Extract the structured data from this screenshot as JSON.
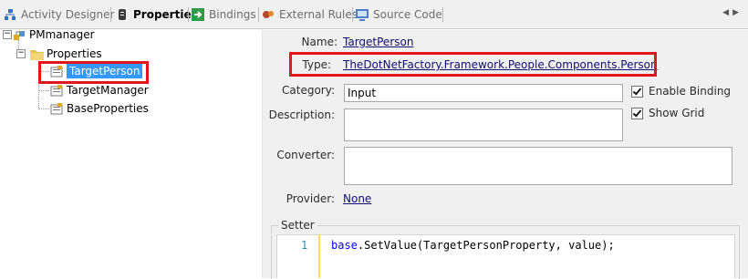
{
  "tabs": [
    {
      "label": "Activity Designer",
      "icon": "activity-designer-icon",
      "active": false
    },
    {
      "label": "Properties",
      "icon": "properties-icon",
      "active": true
    },
    {
      "label": "Bindings",
      "icon": "bindings-icon",
      "active": false
    },
    {
      "label": "External Rules",
      "icon": "external-rules-icon",
      "active": false
    },
    {
      "label": "Source Code",
      "icon": "source-code-icon",
      "active": false
    }
  ],
  "tree": {
    "root": "PMmanager",
    "folder": "Properties",
    "items": [
      "TargetPerson",
      "TargetManager",
      "BaseProperties"
    ],
    "selected": "TargetPerson"
  },
  "details": {
    "name_label": "Name:",
    "name_value": "TargetPerson",
    "type_label": "Type:",
    "type_value": "TheDotNetFactory.Framework.People.Components.Person",
    "category_label": "Category:",
    "category_value": "Input",
    "description_label": "Description:",
    "description_value": "",
    "converter_label": "Converter:",
    "converter_value": "",
    "provider_label": "Provider:",
    "provider_value": "None",
    "enable_binding_label": "Enable Binding",
    "enable_binding_checked": true,
    "show_grid_label": "Show Grid",
    "show_grid_checked": true
  },
  "setter": {
    "title": "Setter",
    "line_number": "1",
    "code_keyword": "base",
    "code_rest": ".SetValue(TargetPersonProperty, value);"
  },
  "colors": {
    "highlight": "#e0161d",
    "selection": "#3399ff",
    "link": "#10106e",
    "panel": "#f0f0f0"
  }
}
